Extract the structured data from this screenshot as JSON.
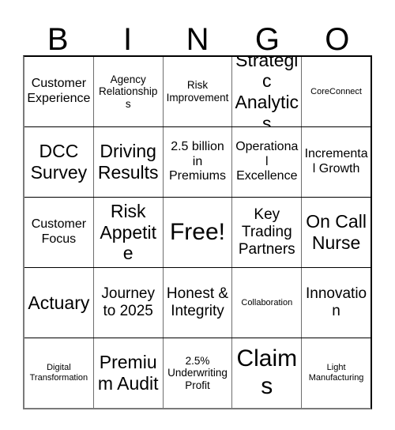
{
  "card": {
    "header_letters": [
      "B",
      "I",
      "N",
      "G",
      "O"
    ],
    "rows": [
      [
        {
          "text": "Customer Experience",
          "size": "m"
        },
        {
          "text": "Agency Relationships",
          "size": "s"
        },
        {
          "text": "Risk Improvement",
          "size": "s"
        },
        {
          "text": "Strategic Analytics",
          "size": "xl"
        },
        {
          "text": "CoreConnect",
          "size": "xs"
        }
      ],
      [
        {
          "text": "DCC Survey",
          "size": "xl"
        },
        {
          "text": "Driving Results",
          "size": "xl"
        },
        {
          "text": "2.5 billion in Premiums",
          "size": "m"
        },
        {
          "text": "Operational Excellence",
          "size": "m"
        },
        {
          "text": "Incremental Growth",
          "size": "m"
        }
      ],
      [
        {
          "text": "Customer Focus",
          "size": "m"
        },
        {
          "text": "Risk Appetite",
          "size": "xl"
        },
        {
          "text": "Free!",
          "size": "xxl"
        },
        {
          "text": "Key Trading Partners",
          "size": "l"
        },
        {
          "text": "On Call Nurse",
          "size": "xl"
        }
      ],
      [
        {
          "text": "Actuary",
          "size": "xl"
        },
        {
          "text": "Journey to 2025",
          "size": "l"
        },
        {
          "text": "Honest & Integrity",
          "size": "l"
        },
        {
          "text": "Collaboration",
          "size": "xs"
        },
        {
          "text": "Innovation",
          "size": "l"
        }
      ],
      [
        {
          "text": "Digital Transformation",
          "size": "xs"
        },
        {
          "text": "Premium Audit",
          "size": "xl"
        },
        {
          "text": "2.5% Underwriting Profit",
          "size": "s"
        },
        {
          "text": "Claims",
          "size": "xxl"
        },
        {
          "text": "Light Manufacturing",
          "size": "xs"
        }
      ]
    ]
  }
}
